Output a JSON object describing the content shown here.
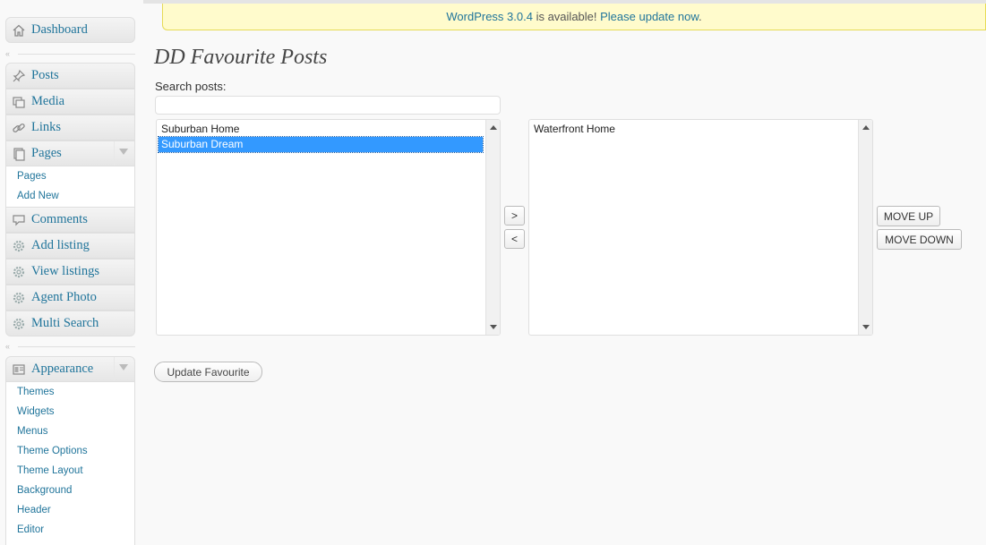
{
  "sidebar": {
    "dashboard": {
      "label": "Dashboard",
      "icon": "home-icon"
    },
    "posts": {
      "label": "Posts",
      "icon": "pushpin-icon"
    },
    "media": {
      "label": "Media",
      "icon": "media-icon"
    },
    "links": {
      "label": "Links",
      "icon": "link-icon"
    },
    "pages": {
      "label": "Pages",
      "icon": "pages-icon",
      "sub": [
        "Pages",
        "Add New"
      ]
    },
    "comments": {
      "label": "Comments",
      "icon": "comment-icon"
    },
    "add_listing": {
      "label": "Add listing",
      "icon": "cog-icon"
    },
    "view_listings": {
      "label": "View listings",
      "icon": "cog-icon"
    },
    "agent_photo": {
      "label": "Agent Photo",
      "icon": "cog-icon"
    },
    "multi_search": {
      "label": "Multi Search",
      "icon": "cog-icon"
    },
    "appearance": {
      "label": "Appearance",
      "icon": "appearance-icon",
      "sub": [
        "Themes",
        "Widgets",
        "Menus",
        "Theme Options",
        "Theme Layout",
        "Background",
        "Header",
        "Editor"
      ]
    },
    "collapse_glyph": "«"
  },
  "update_nag": {
    "link_version": "WordPress 3.0.4",
    "middle_text": " is available! ",
    "link_update": "Please update now",
    "end_text": "."
  },
  "main": {
    "title": "DD Favourite Posts",
    "search_label": "Search posts:",
    "search_value": "",
    "available_posts": [
      {
        "label": "Suburban Home",
        "selected": false
      },
      {
        "label": "Suburban Dream",
        "selected": true
      }
    ],
    "favourite_posts": [
      {
        "label": "Waterfront Home",
        "selected": false
      }
    ],
    "add_button": ">",
    "remove_button": "<",
    "move_up_button": "MOVE UP",
    "move_down_button": "MOVE DOWN",
    "update_button": "Update Favourite"
  },
  "colors": {
    "link": "#21759b",
    "selection": "#3399ff",
    "nag_bg": "#fffbcc"
  }
}
